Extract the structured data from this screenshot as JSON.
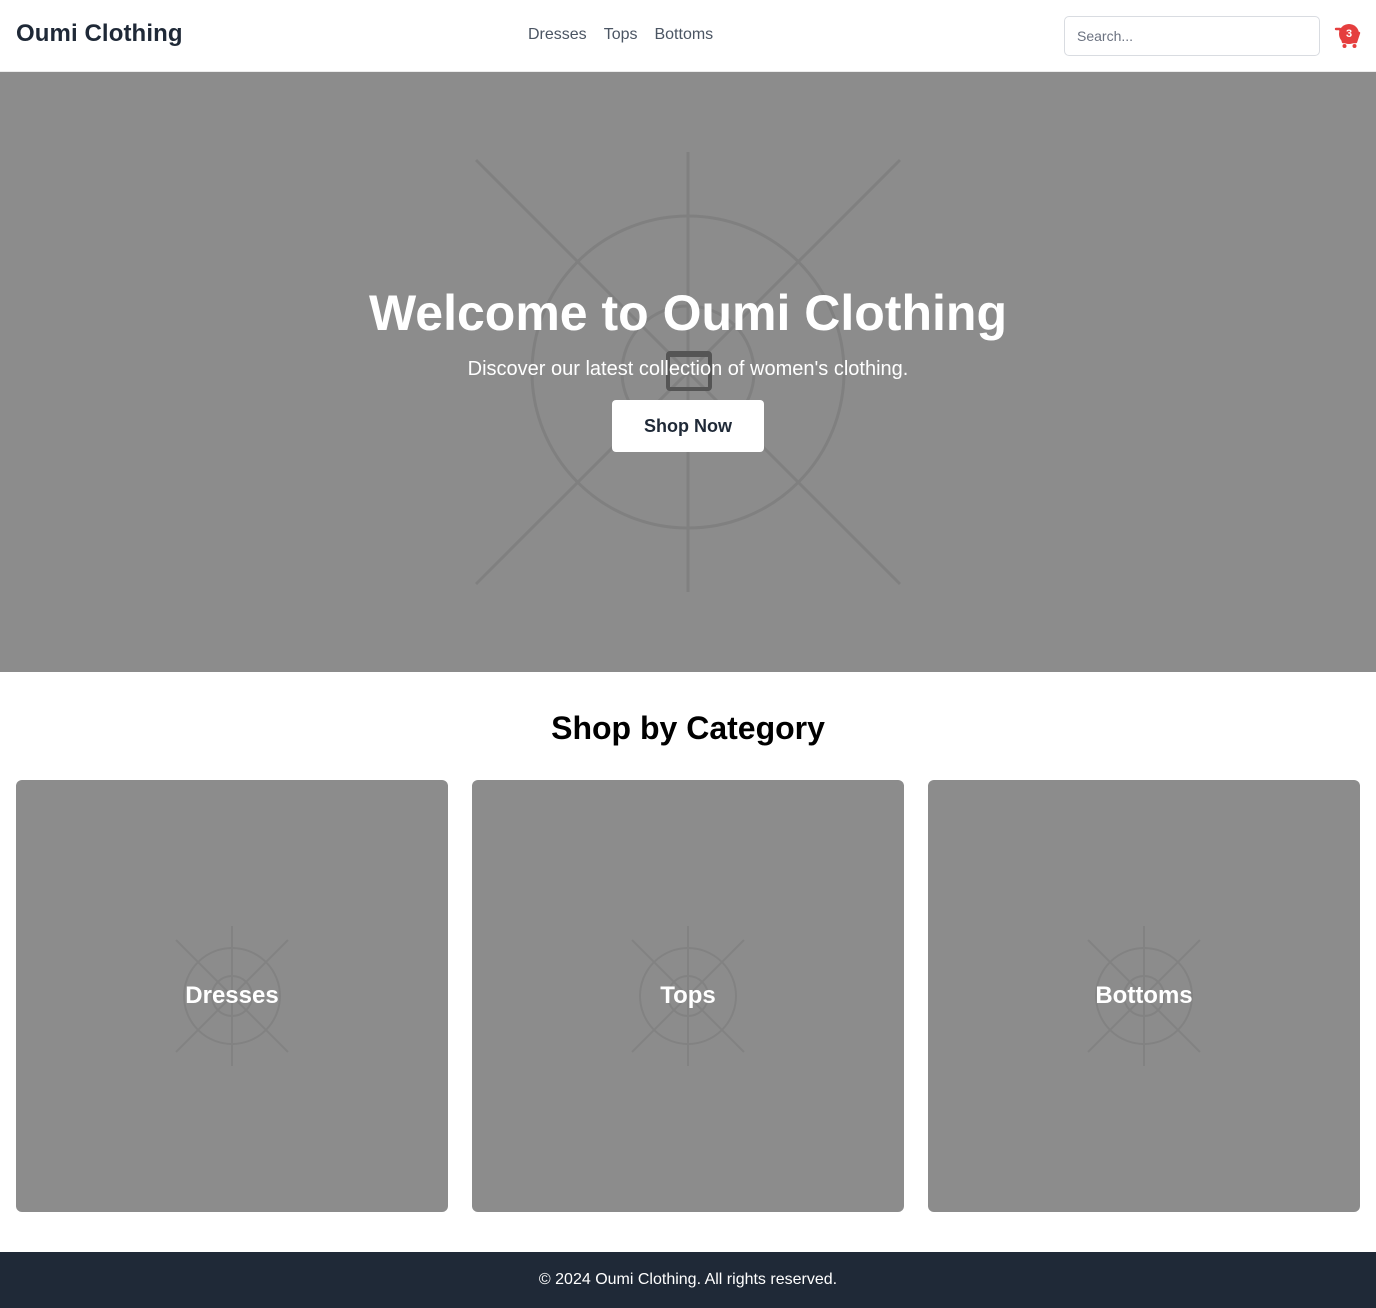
{
  "header": {
    "logo": "Oumi Clothing",
    "nav": [
      {
        "label": "Dresses"
      },
      {
        "label": "Tops"
      },
      {
        "label": "Bottoms"
      }
    ],
    "search_placeholder": "Search...",
    "cart_count": "3",
    "cart_icon": "shopping-cart-icon"
  },
  "hero": {
    "title": "Welcome to Oumi Clothing",
    "subtitle": "Discover our latest collection of women's clothing.",
    "button_label": "Shop Now",
    "placeholder_icon": "image-placeholder-icon"
  },
  "categories": {
    "title": "Shop by Category",
    "items": [
      {
        "label": "Dresses"
      },
      {
        "label": "Tops"
      },
      {
        "label": "Bottoms"
      }
    ]
  },
  "footer": {
    "text": "© 2024 Oumi Clothing. All rights reserved."
  },
  "colors": {
    "placeholder_bg": "#8c8c8c",
    "footer_bg": "#1f2937",
    "badge": "#e53e3e",
    "text_dark": "#1f2937"
  }
}
